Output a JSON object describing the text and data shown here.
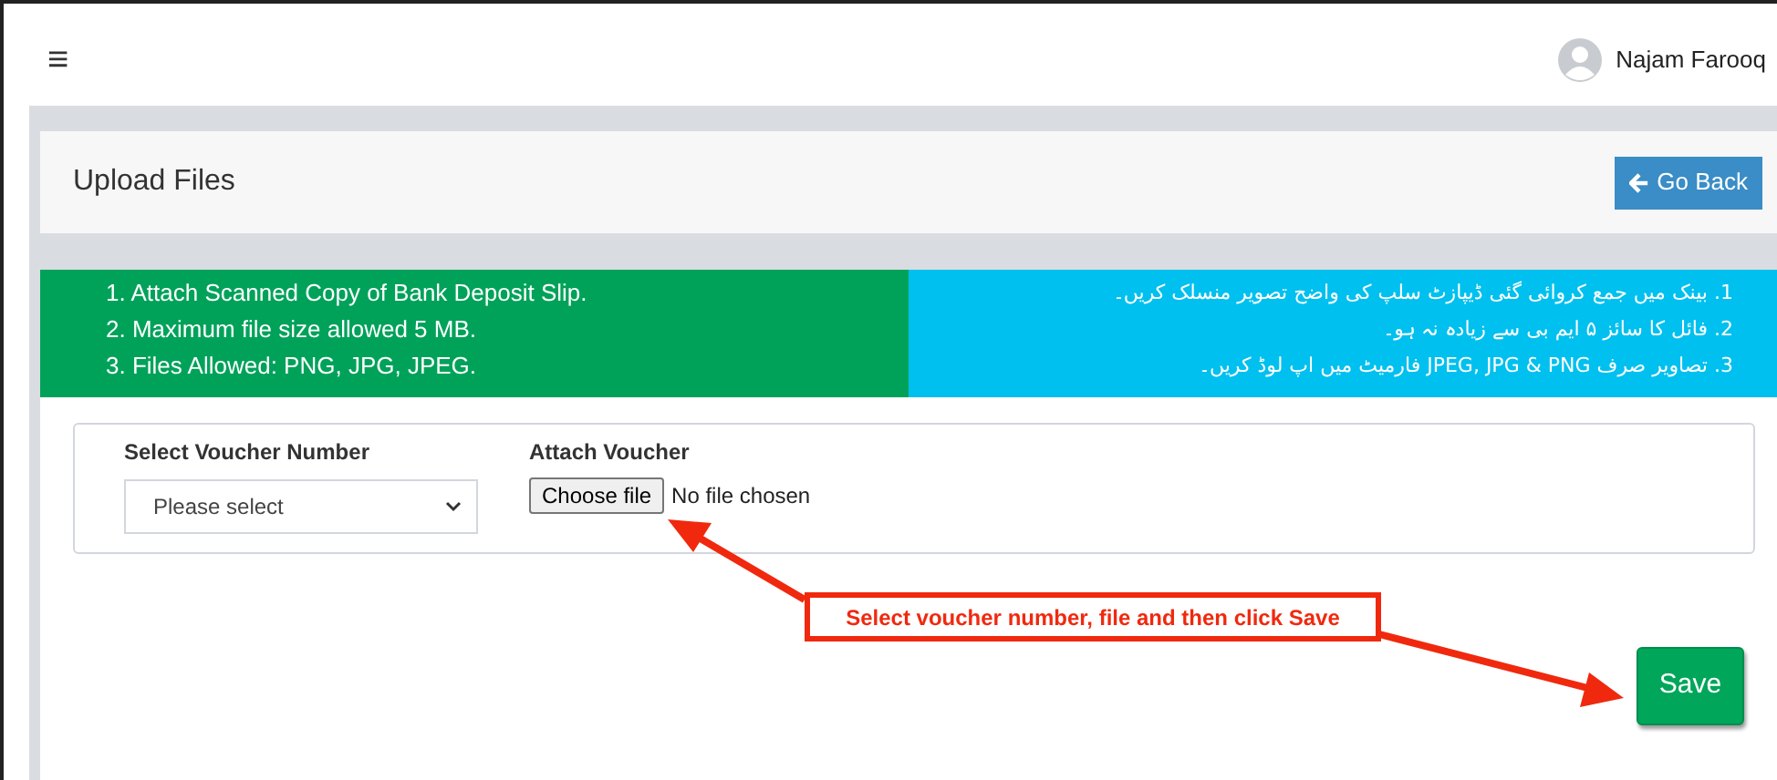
{
  "topbar": {
    "menu_icon": "≡",
    "user": {
      "name": "Najam Farooq"
    }
  },
  "header": {
    "title": "Upload Files",
    "back_button": "Go Back"
  },
  "instructions": {
    "english": [
      "1. Attach Scanned Copy of Bank Deposit Slip.",
      "2. Maximum file size allowed 5 MB.",
      "3. Files Allowed: PNG, JPG, JPEG."
    ],
    "urdu": [
      "1. بینک میں جمع کروائی گئی ڈیپازٹ سلپ کی واضح تصویر منسلک کریں۔",
      "2. فائل کا سائز ۵ ایم بی سے زیادہ نہ ہو۔",
      "3. تصاویر صرف JPEG, JPG & PNG فارمیٹ میں اپ لوڈ کریں۔"
    ]
  },
  "form": {
    "voucher_label": "Select Voucher Number",
    "voucher_placeholder": "Please select",
    "attach_label": "Attach Voucher",
    "file_button": "Choose file",
    "file_status": "No file chosen"
  },
  "annotation": {
    "callout": "Select voucher number, file and then click Save"
  },
  "save_button": "Save"
}
